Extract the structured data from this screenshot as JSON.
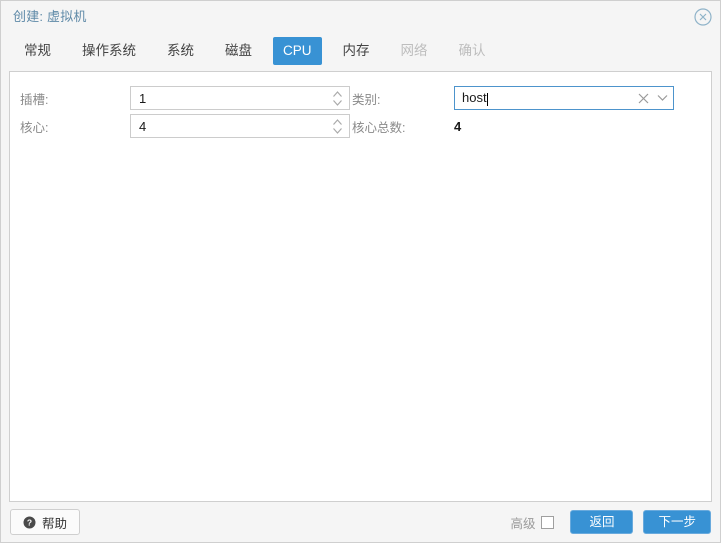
{
  "window": {
    "title": "创建: 虚拟机",
    "close_icon": "close-circle-icon"
  },
  "tabs": [
    {
      "label": "常规",
      "state": "normal"
    },
    {
      "label": "操作系统",
      "state": "normal"
    },
    {
      "label": "系统",
      "state": "normal"
    },
    {
      "label": "磁盘",
      "state": "normal"
    },
    {
      "label": "CPU",
      "state": "active"
    },
    {
      "label": "内存",
      "state": "normal"
    },
    {
      "label": "网络",
      "state": "disabled"
    },
    {
      "label": "确认",
      "state": "disabled"
    }
  ],
  "form": {
    "sockets": {
      "label": "插槽:",
      "value": "1",
      "spinner_icon": "spinner-arrows-icon"
    },
    "cores": {
      "label": "核心:",
      "value": "4",
      "spinner_icon": "spinner-arrows-icon"
    },
    "type": {
      "label": "类别:",
      "value": "host",
      "clear_icon": "clear-x-icon",
      "dropdown_icon": "chevron-down-icon"
    },
    "total_cores": {
      "label": "核心总数:",
      "value": "4"
    }
  },
  "footer": {
    "help_label": "帮助",
    "help_icon": "question-circle-icon",
    "advanced_label": "高级",
    "advanced_checked": false,
    "back_label": "返回",
    "next_label": "下一步"
  },
  "colors": {
    "accent": "#3892d4",
    "title_text": "#5f8aa8",
    "label_text": "#8a8a8a",
    "disabled_tab": "#bdbdbd",
    "panel_bg": "#f5f5f5",
    "content_bg": "#ffffff",
    "focus_border": "#4d94cc"
  }
}
